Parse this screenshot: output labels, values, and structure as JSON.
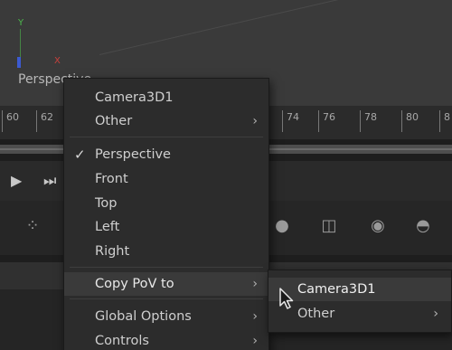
{
  "viewport": {
    "label": "Perspective",
    "axis_y": "Y",
    "axis_x": "X"
  },
  "ruler": {
    "ticks": [
      "60",
      "62",
      "74",
      "76",
      "78",
      "80",
      "8"
    ]
  },
  "transport": {
    "play_icon": "play-icon",
    "fast_forward_icon": "fast-forward-icon"
  },
  "context_menu": {
    "camera": "Camera3D1",
    "other": "Other",
    "perspective": "Perspective",
    "front": "Front",
    "top": "Top",
    "left": "Left",
    "right": "Right",
    "copy_pov": "Copy PoV to",
    "global_options": "Global Options",
    "controls": "Controls",
    "arrow": "›",
    "check": "✓"
  },
  "submenu": {
    "camera": "Camera3D1",
    "other": "Other"
  },
  "colors": {
    "menu_bg": "#2c2c2c",
    "highlight": "#3a3a3a",
    "axis_y": "#4cb84c",
    "axis_x": "#c8403c",
    "axis_z": "#3c5ad0"
  }
}
